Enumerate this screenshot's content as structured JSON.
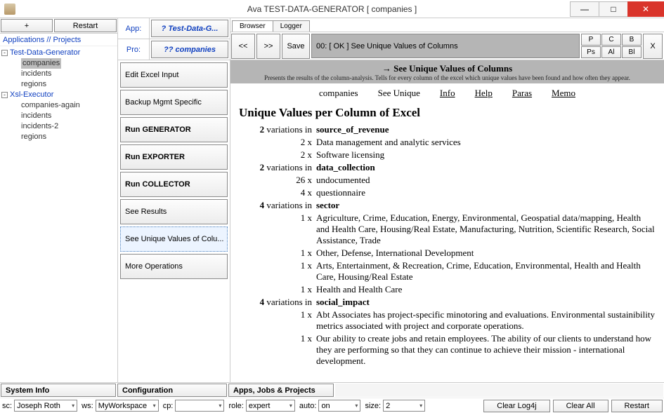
{
  "window": {
    "title": "Ava TEST-DATA-GENERATOR [ companies ]",
    "minimize": "—",
    "maximize": "□",
    "close": "✕"
  },
  "left": {
    "plus": "+",
    "restart": "Restart",
    "header": "Applications // Projects",
    "expander": "⊟",
    "nodes": [
      {
        "label": "Test-Data-Generator",
        "children": [
          "companies",
          "incidents",
          "regions"
        ],
        "selected": 0
      },
      {
        "label": "Xsl-Executor",
        "children": [
          "companies-again",
          "incidents",
          "incidents-2",
          "regions"
        ]
      }
    ]
  },
  "mid": {
    "app_lbl": "App:",
    "app_val": "? Test-Data-G...",
    "pro_lbl": "Pro:",
    "pro_val": "?? companies",
    "buttons": [
      {
        "label": "Edit Excel Input",
        "bold": false
      },
      {
        "label": "Backup Mgmt Specific",
        "bold": false
      },
      {
        "label": "Run GENERATOR",
        "bold": true
      },
      {
        "label": "Run EXPORTER",
        "bold": true
      },
      {
        "label": "Run COLLECTOR",
        "bold": true
      },
      {
        "label": "See Results",
        "bold": false
      },
      {
        "label": "See Unique Values of Colu...",
        "bold": false,
        "active": true
      },
      {
        "label": "More Operations",
        "bold": false
      }
    ]
  },
  "right": {
    "tabs": [
      "Browser",
      "Logger"
    ],
    "active_tab": 0,
    "tool": {
      "back": "<<",
      "fwd": ">>",
      "save": "Save"
    },
    "status": "00: [ OK ] See Unique Values of Columns",
    "grid": [
      "P",
      "C",
      "B",
      "Ps",
      "Al",
      "Bl"
    ],
    "x": "X",
    "banner_title": "→ See Unique Values of Columns",
    "banner_sub": "Presents the results of the column-analysis. Tells for every column of the excel which unique values have been found and how often they appear.",
    "nav": [
      "companies",
      "See Unique",
      "Info",
      "Help",
      "Paras",
      "Memo"
    ],
    "heading": "Unique Values per Column of Excel",
    "sections": [
      {
        "var_label": "2 variations in",
        "col": "source_of_revenue",
        "items": [
          {
            "count": "2 x",
            "text": "Data management and analytic services"
          },
          {
            "count": "2 x",
            "text": "Software licensing"
          }
        ]
      },
      {
        "var_label": "2 variations in",
        "col": "data_collection",
        "items": [
          {
            "count": "26 x",
            "text": "undocumented"
          },
          {
            "count": "4 x",
            "text": "questionnaire"
          }
        ]
      },
      {
        "var_label": "4 variations in",
        "col": "sector",
        "items": [
          {
            "count": "1 x",
            "text": "Agriculture, Crime, Education, Energy, Environmental, Geospatial data/mapping, Health and Health Care, Housing/Real Estate, Manufacturing, Nutrition, Scientific Research, Social Assistance, Trade"
          },
          {
            "count": "1 x",
            "text": "Other, Defense, International Development"
          },
          {
            "count": "1 x",
            "text": "Arts, Entertainment, & Recreation, Crime, Education, Environmental, Health and Health Care, Housing/Real Estate"
          },
          {
            "count": "1 x",
            "text": "Health and Health Care"
          }
        ]
      },
      {
        "var_label": "4 variations in",
        "col": "social_impact",
        "items": [
          {
            "count": "1 x",
            "text": "Abt Associates has project-specific minotoring and evaluations. Environmental sustainibility metrics associated with project and corporate operations."
          },
          {
            "count": "1 x",
            "text": "Our ability to create jobs and retain employees. The ability of our clients to understand how they are performing so that they can continue to achieve their mission - international development."
          }
        ]
      }
    ]
  },
  "status1": {
    "sysinfo": "System Info",
    "config": "Configuration",
    "apps": "Apps, Jobs & Projects"
  },
  "status2": {
    "sc_lbl": "sc:",
    "sc_val": "Joseph Roth",
    "ws_lbl": "ws:",
    "ws_val": "MyWorkspace",
    "cp_lbl": "cp:",
    "cp_val": "",
    "role_lbl": "role:",
    "role_val": "expert",
    "auto_lbl": "auto:",
    "auto_val": "on",
    "size_lbl": "size:",
    "size_val": "2",
    "clear_log": "Clear Log4j",
    "clear_all": "Clear All",
    "restart": "Restart"
  }
}
